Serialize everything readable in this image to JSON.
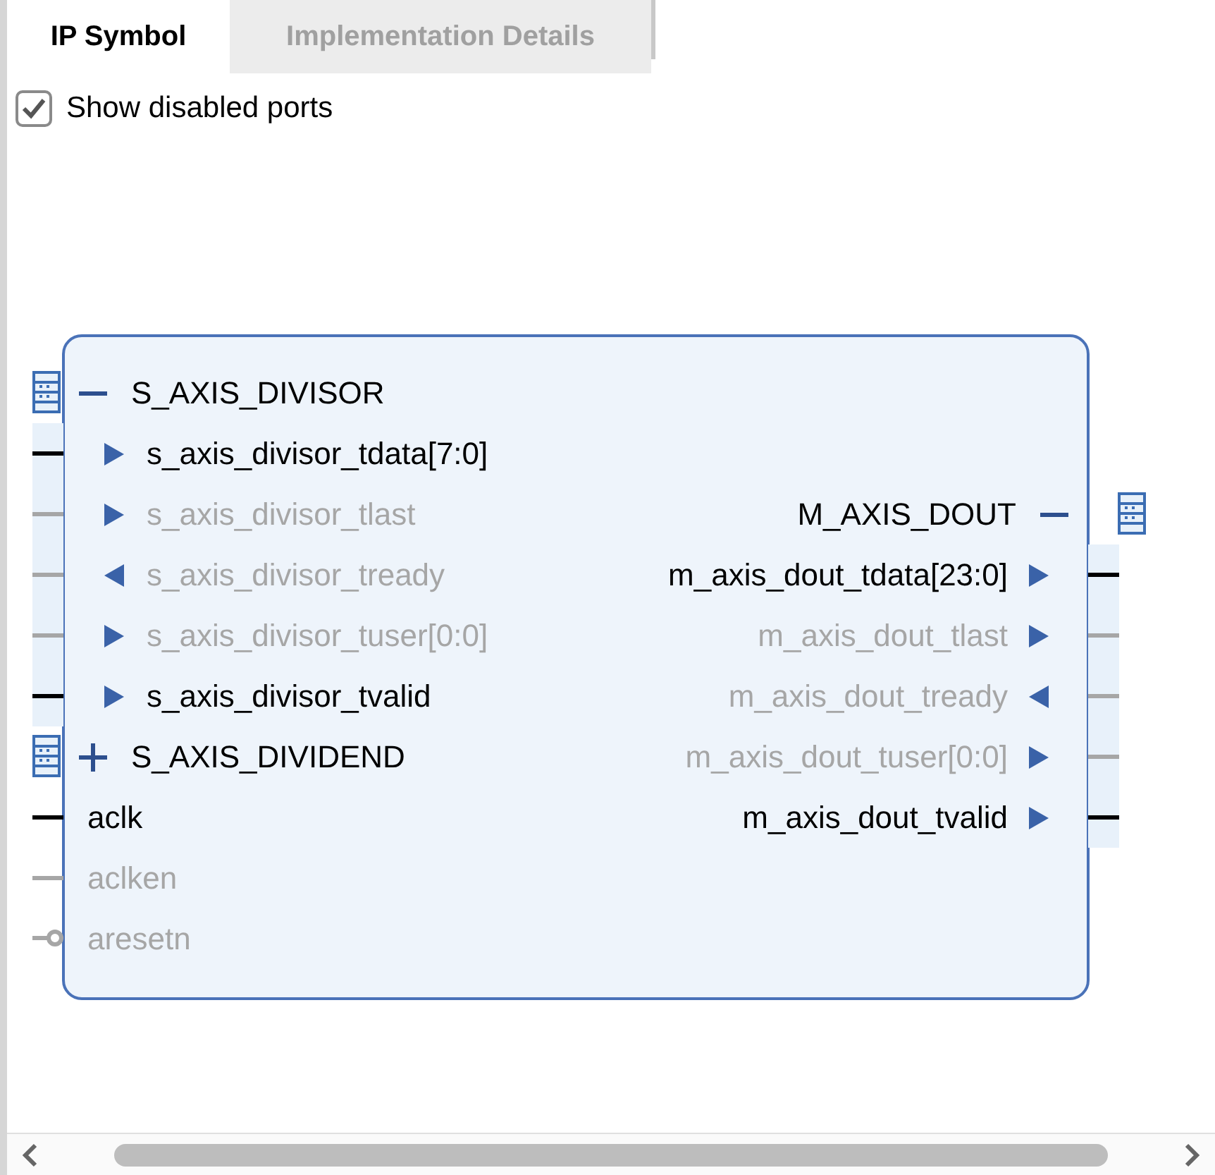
{
  "tabs": [
    {
      "label": "IP Symbol",
      "selected": true
    },
    {
      "label": "Implementation Details",
      "selected": false
    }
  ],
  "show_disabled_ports": {
    "label": "Show disabled ports",
    "checked": true
  },
  "block": {
    "left_pins": [
      {
        "kind": "bus",
        "label": "S_AXIS_DIVISOR",
        "expanded": true,
        "children": [
          {
            "kind": "port",
            "label": "s_axis_divisor_tdata[7:0]",
            "is_input": true,
            "enabled": true
          },
          {
            "kind": "port",
            "label": "s_axis_divisor_tlast",
            "is_input": true,
            "enabled": false
          },
          {
            "kind": "port",
            "label": "s_axis_divisor_tready",
            "is_input": false,
            "enabled": false
          },
          {
            "kind": "port",
            "label": "s_axis_divisor_tuser[0:0]",
            "is_input": true,
            "enabled": false
          },
          {
            "kind": "port",
            "label": "s_axis_divisor_tvalid",
            "is_input": true,
            "enabled": true
          }
        ]
      },
      {
        "kind": "bus",
        "label": "S_AXIS_DIVIDEND",
        "expanded": false
      },
      {
        "kind": "signal",
        "label": "aclk",
        "enabled": true,
        "negated": false
      },
      {
        "kind": "signal",
        "label": "aclken",
        "enabled": false,
        "negated": false
      },
      {
        "kind": "signal",
        "label": "aresetn",
        "enabled": false,
        "negated": true
      }
    ],
    "right_pins": [
      {
        "kind": "bus",
        "label": "M_AXIS_DOUT",
        "expanded": true,
        "children": [
          {
            "kind": "port",
            "label": "m_axis_dout_tdata[23:0]",
            "is_input": false,
            "enabled": true
          },
          {
            "kind": "port",
            "label": "m_axis_dout_tlast",
            "is_input": false,
            "enabled": false
          },
          {
            "kind": "port",
            "label": "m_axis_dout_tready",
            "is_input": true,
            "enabled": false
          },
          {
            "kind": "port",
            "label": "m_axis_dout_tuser[0:0]",
            "is_input": false,
            "enabled": false
          },
          {
            "kind": "port",
            "label": "m_axis_dout_tvalid",
            "is_input": false,
            "enabled": true
          }
        ]
      }
    ]
  }
}
